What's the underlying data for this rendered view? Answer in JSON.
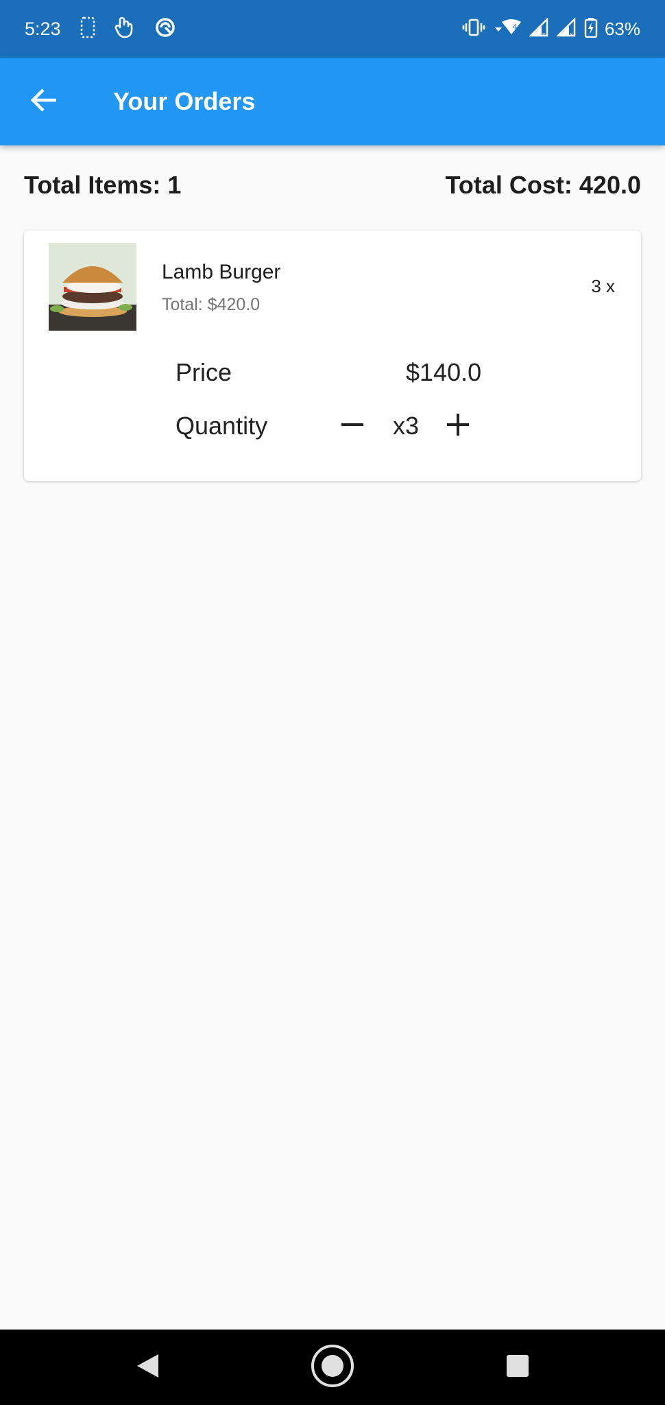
{
  "status_bar": {
    "time": "5:23",
    "battery": "63%"
  },
  "app_bar": {
    "title": "Your Orders"
  },
  "summary": {
    "total_items": "Total Items: 1",
    "total_cost": "Total Cost: 420.0"
  },
  "order_item": {
    "name": "Lamb Burger",
    "total": "Total: $420.0",
    "qty_badge": "3 x",
    "price_label": "Price",
    "price_value": "$140.0",
    "quantity_label": "Quantity",
    "quantity_value": "x3"
  },
  "colors": {
    "status_bar": "#1b6fba",
    "app_bar": "#2196f3",
    "background": "#fafafa",
    "nav_bar": "#000000"
  },
  "icons": {
    "back": "arrow-back-icon",
    "minus": "minus-icon",
    "plus": "plus-icon",
    "nav_back": "nav-back-triangle-icon",
    "nav_home": "nav-home-circle-icon",
    "nav_recent": "nav-recent-square-icon"
  }
}
